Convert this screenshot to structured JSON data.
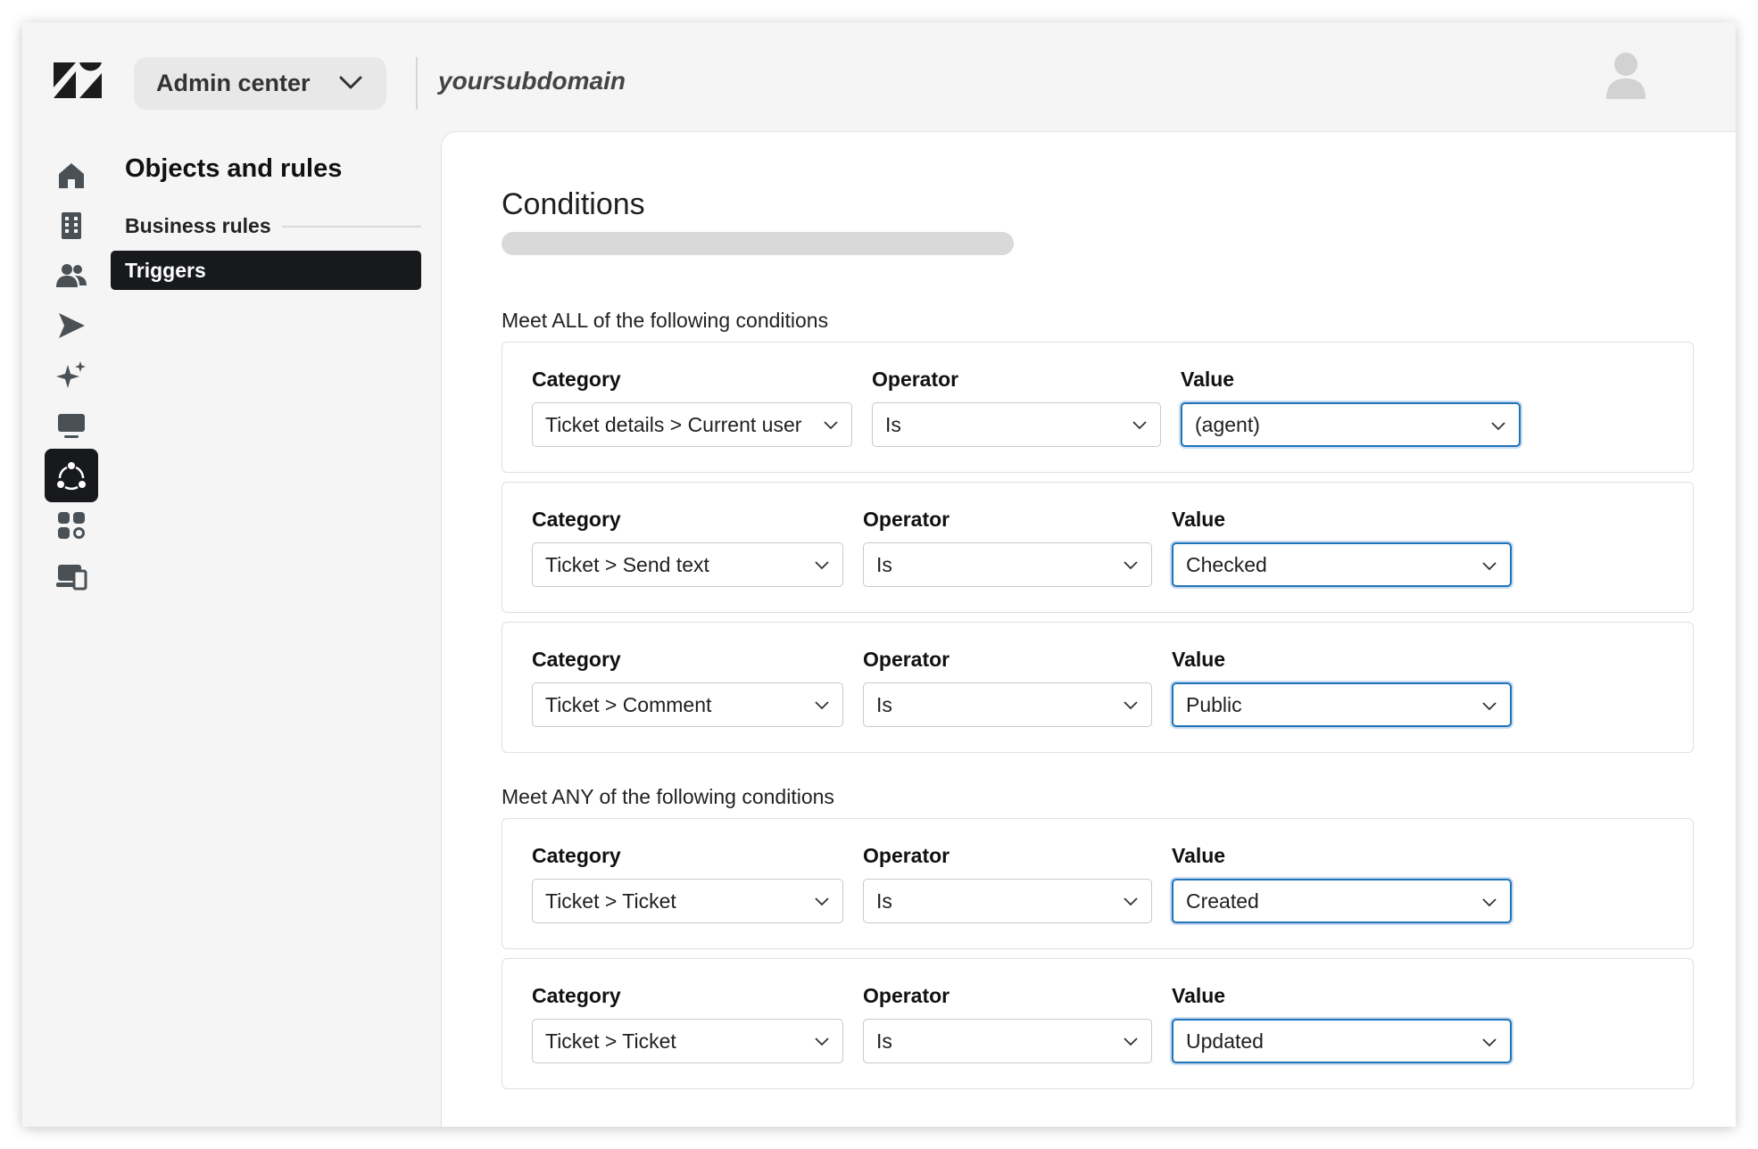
{
  "header": {
    "product_switcher": "Admin center",
    "subdomain": "yoursubdomain",
    "logo_icon": "zendesk-logo-icon",
    "avatar_icon": "user-avatar-icon"
  },
  "nav": {
    "icons": [
      "home-icon",
      "organization-icon",
      "people-icon",
      "channels-icon",
      "ai-sparkle-icon",
      "workspaces-icon",
      "objects-rules-icon",
      "apps-icon",
      "account-icon"
    ],
    "active": "objects-rules-icon"
  },
  "sidebar": {
    "title": "Objects and rules",
    "section": "Business rules",
    "selected_item": "Triggers"
  },
  "main": {
    "title": "Conditions",
    "all_group": {
      "label": "Meet ALL of the following conditions",
      "conditions": [
        {
          "category_label": "Category",
          "category": "Ticket details > Current user",
          "operator_label": "Operator",
          "operator": "Is",
          "value_label": "Value",
          "value": "(agent)"
        },
        {
          "category_label": "Category",
          "category": "Ticket > Send text",
          "operator_label": "Operator",
          "operator": "Is",
          "value_label": "Value",
          "value": "Checked"
        },
        {
          "category_label": "Category",
          "category": "Ticket > Comment",
          "operator_label": "Operator",
          "operator": "Is",
          "value_label": "Value",
          "value": "Public"
        }
      ]
    },
    "any_group": {
      "label": "Meet ANY of the following conditions",
      "conditions": [
        {
          "category_label": "Category",
          "category": "Ticket > Ticket",
          "operator_label": "Operator",
          "operator": "Is",
          "value_label": "Value",
          "value": "Created"
        },
        {
          "category_label": "Category",
          "category": "Ticket > Ticket",
          "operator_label": "Operator",
          "operator": "Is",
          "value_label": "Value",
          "value": "Updated"
        }
      ]
    }
  },
  "colors": {
    "focus_border": "#1f73b7",
    "active_nav": "#17191c",
    "page_background": "#f5f5f5"
  }
}
